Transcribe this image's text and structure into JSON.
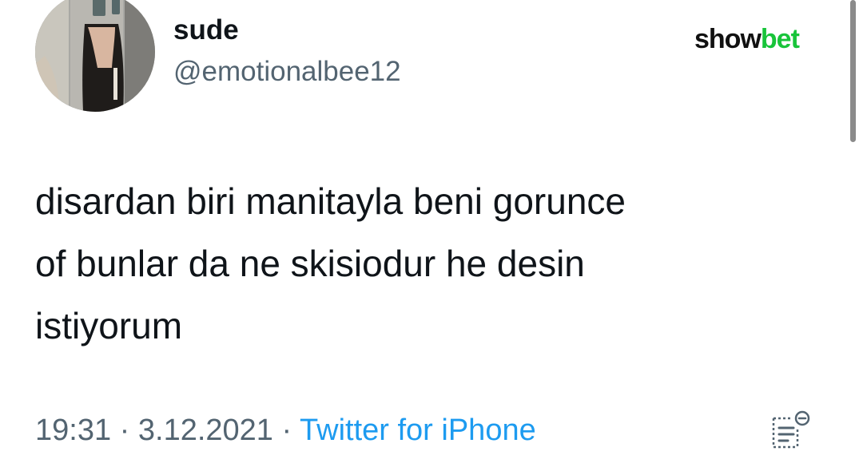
{
  "author": {
    "display_name": "sude",
    "handle": "@emotionalbee12"
  },
  "watermark": {
    "part1": "show",
    "part2": "bet",
    "color_dark": "#111111",
    "color_accent": "#18c43a"
  },
  "tweet": {
    "lines": [
      "disardan biri manitayla beni gorunce",
      "of bunlar da ne skisiodur he desin",
      "istiyorum"
    ]
  },
  "meta": {
    "time": "19:31",
    "date": "3.12.2021",
    "separator": " · ",
    "source": "Twitter for iPhone"
  },
  "icons": {
    "analytics": "analytics-icon",
    "avatar": "avatar"
  },
  "colors": {
    "text": "#0f1419",
    "secondary": "#536471",
    "link": "#1d9bf0"
  }
}
